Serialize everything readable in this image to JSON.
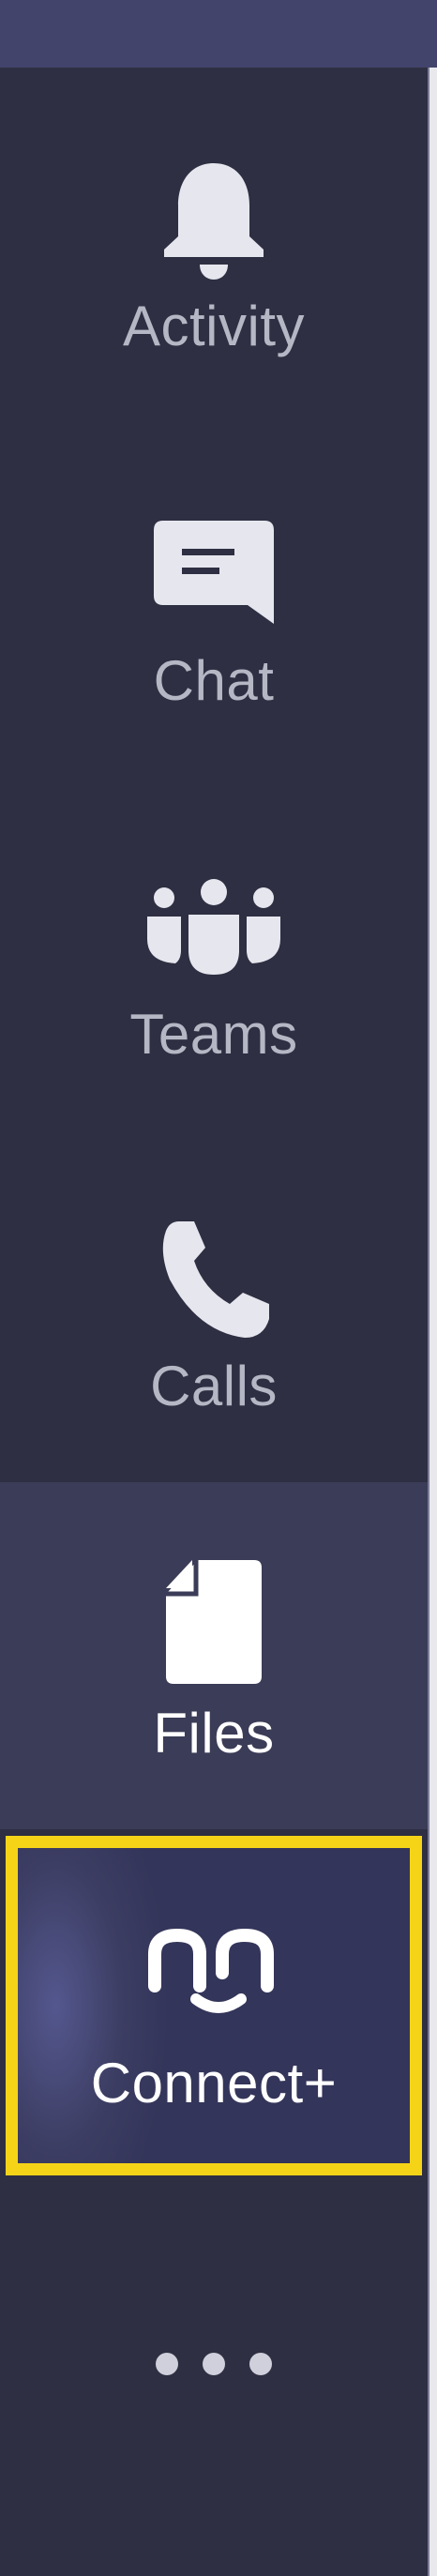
{
  "rail": {
    "items": [
      {
        "id": "activity",
        "label": "Activity",
        "icon": "bell-icon"
      },
      {
        "id": "chat",
        "label": "Chat",
        "icon": "chat-bubble-icon"
      },
      {
        "id": "teams",
        "label": "Teams",
        "icon": "teams-people-icon"
      },
      {
        "id": "calls",
        "label": "Calls",
        "icon": "phone-icon"
      },
      {
        "id": "files",
        "label": "Files",
        "icon": "file-icon",
        "selected": true
      },
      {
        "id": "connect",
        "label": "Connect+",
        "icon": "connect-plus-logo-icon",
        "highlighted": true
      }
    ],
    "more": {
      "icon": "more-options-icon"
    }
  },
  "colors": {
    "rail_background": "#2e2f42",
    "selected_background": "#3b3c57",
    "highlight_border": "#f5d418",
    "inactive_label": "#b6b7c5",
    "active_label": "#ffffff"
  }
}
